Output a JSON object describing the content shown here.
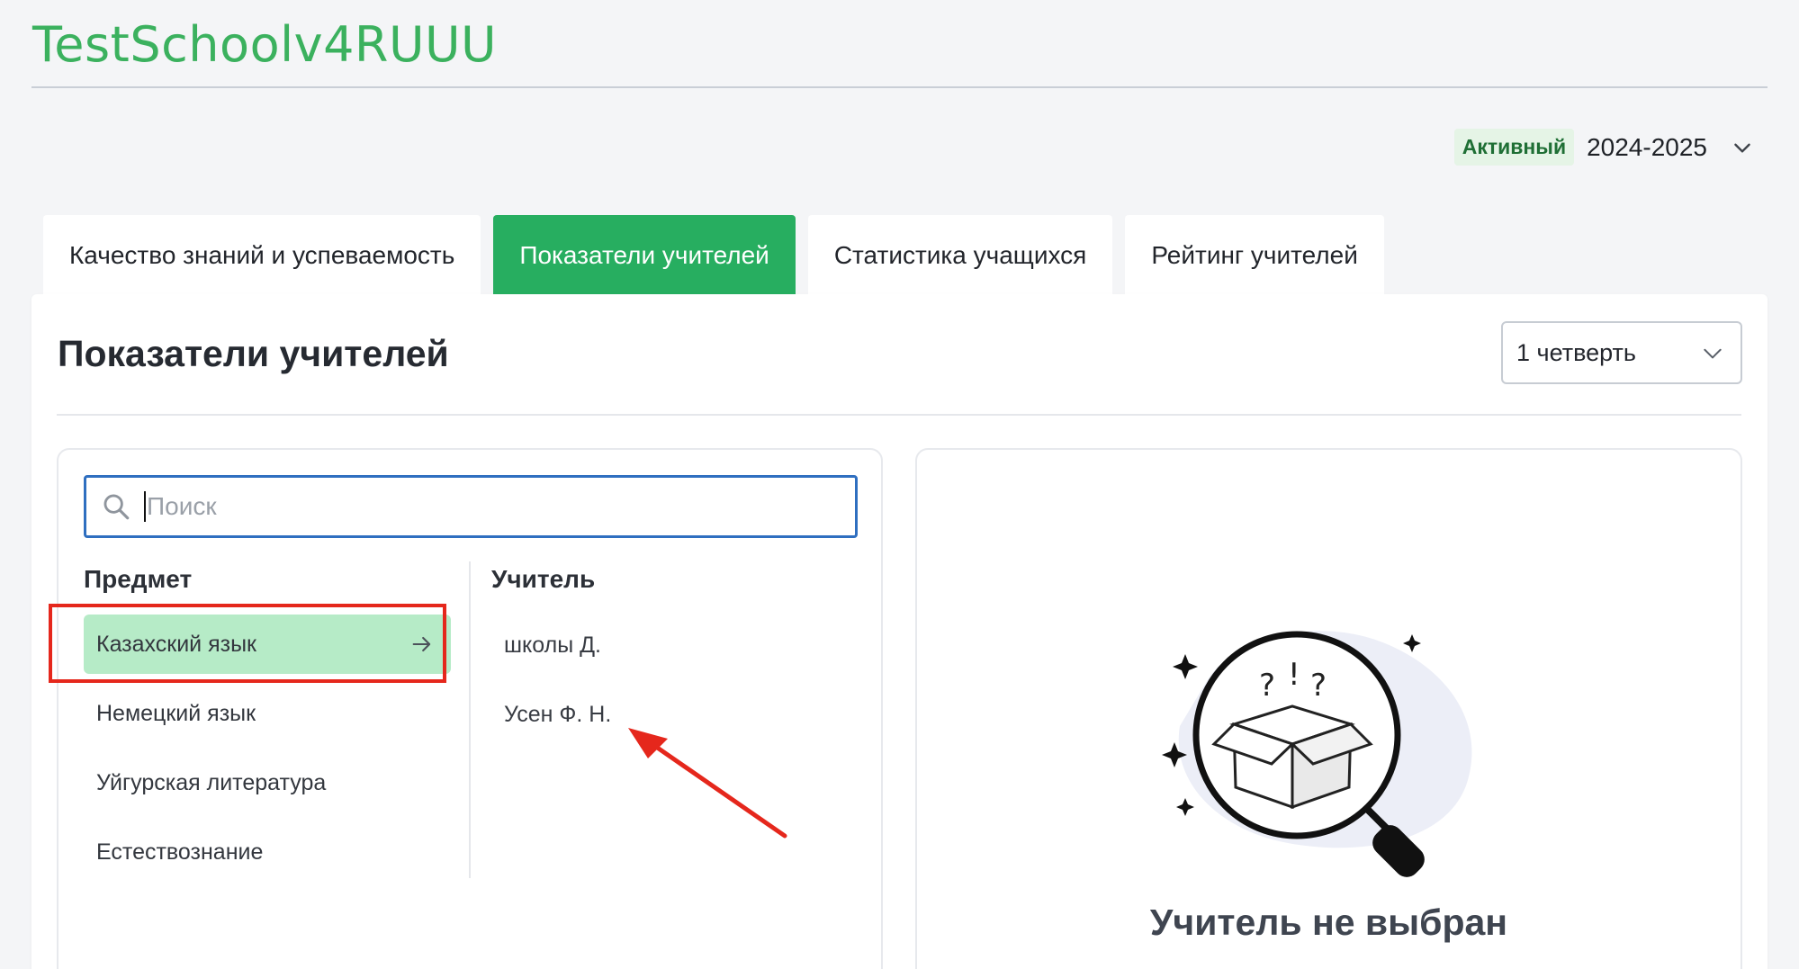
{
  "header": {
    "school_name": "TestSchoolv4RUUU",
    "year_status": "Активный",
    "academic_year": "2024-2025"
  },
  "tabs": [
    {
      "label": "Качество знаний и успеваемость",
      "active": false
    },
    {
      "label": "Показатели учителей",
      "active": true
    },
    {
      "label": "Статистика учащихся",
      "active": false
    },
    {
      "label": "Рейтинг учителей",
      "active": false
    }
  ],
  "panel": {
    "title": "Показатели учителей",
    "quarter": "1 четверть"
  },
  "search": {
    "placeholder": "Поиск",
    "value": ""
  },
  "subjects": {
    "header": "Предмет",
    "items": [
      {
        "label": "Казахский язык",
        "selected": true
      },
      {
        "label": "Немецкий язык",
        "selected": false
      },
      {
        "label": "Уйгурская литература",
        "selected": false
      },
      {
        "label": "Естествознание",
        "selected": false
      }
    ]
  },
  "teachers": {
    "header": "Учитель",
    "items": [
      {
        "label": "школы Д."
      },
      {
        "label": "Усен Ф. Н."
      }
    ]
  },
  "empty_state": {
    "message": "Учитель не выбран",
    "icon": "magnifier-box-icon"
  },
  "colors": {
    "brand_green": "#27ae60",
    "title_green": "#3bb15e",
    "selected_bg": "#b6ebc7",
    "focus_blue": "#2f6fc0",
    "annotation_red": "#e5271c"
  }
}
